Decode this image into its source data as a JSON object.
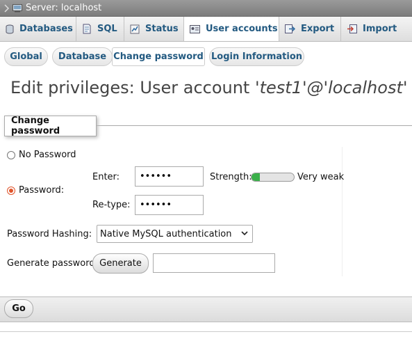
{
  "titlebar": {
    "text": "Server: localhost"
  },
  "tabs": [
    {
      "label": "Databases",
      "icon": "database-icon"
    },
    {
      "label": "SQL",
      "icon": "sql-icon"
    },
    {
      "label": "Status",
      "icon": "status-icon"
    },
    {
      "label": "User accounts",
      "icon": "user-accounts-icon"
    },
    {
      "label": "Export",
      "icon": "export-icon"
    },
    {
      "label": "Import",
      "icon": "import-icon"
    }
  ],
  "subtabs": [
    "Global",
    "Database",
    "Change password",
    "Login Information"
  ],
  "heading": {
    "prefix": "Edit privileges: User account ",
    "account": "'test1'@'localhost'"
  },
  "legend": "Change password",
  "form": {
    "no_password_label": "No Password",
    "password_label": "Password:",
    "enter_label": "Enter:",
    "enter_value": "••••••",
    "retype_label": "Re-type:",
    "retype_value": "••••••",
    "strength_label": "Strength:",
    "strength_value": "Very weak",
    "strength_level": 0.2,
    "hashing_label": "Password Hashing:",
    "hashing_value": "Native MySQL authentication",
    "generate_label": "Generate password",
    "generate_button": "Generate",
    "generated_value": ""
  },
  "go_button": "Go",
  "colors": {
    "link": "#235a81",
    "accent_radio": "#e0542b",
    "strength_fill": "#3bb04a"
  }
}
